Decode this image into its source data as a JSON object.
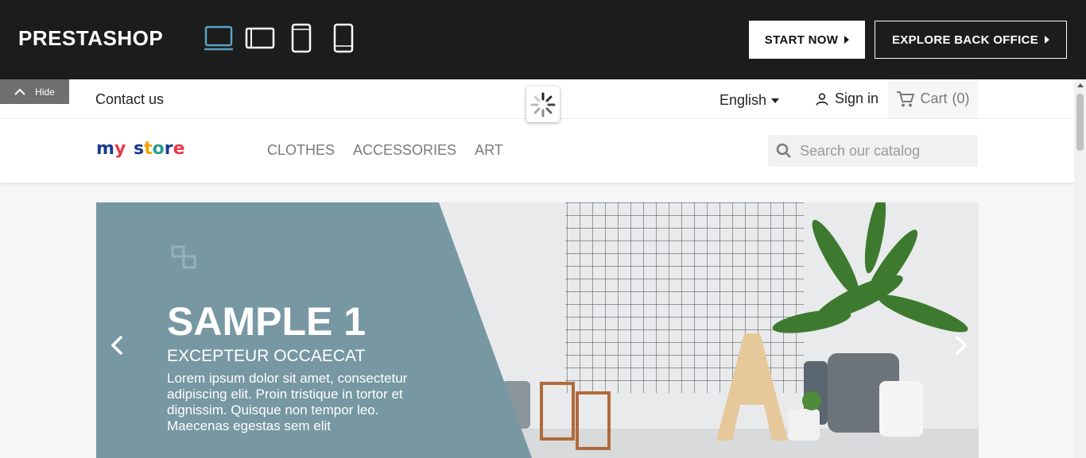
{
  "demo_bar": {
    "logo": "PRESTASHOP",
    "devices": [
      "desktop-icon",
      "tablet-landscape-icon",
      "tablet-portrait-icon",
      "mobile-icon"
    ],
    "active_device_color": "#5aa2c5",
    "start_label": "START NOW",
    "explore_label": "EXPLORE BACK OFFICE"
  },
  "store": {
    "hide_label": "Hide",
    "contact_label": "Contact us",
    "language": "English",
    "signin_label": "Sign in",
    "cart_label": "Cart",
    "cart_count": "(0)",
    "brand_letters": [
      {
        "ch": "m",
        "color": "#1a3b8c"
      },
      {
        "ch": "y",
        "color": "#e63946"
      },
      {
        "ch": " ",
        "color": "#000"
      },
      {
        "ch": "s",
        "color": "#1a3b8c"
      },
      {
        "ch": "t",
        "color": "#f4a300"
      },
      {
        "ch": "o",
        "color": "#2a9d8f"
      },
      {
        "ch": "r",
        "color": "#1a3b8c"
      },
      {
        "ch": "e",
        "color": "#e63946"
      }
    ],
    "menu": [
      "CLOTHES",
      "ACCESSORIES",
      "ART"
    ],
    "search_placeholder": "Search our catalog"
  },
  "slide": {
    "title": "SAMPLE 1",
    "subtitle": "EXCEPTEUR OCCAECAT",
    "description": "Lorem ipsum dolor sit amet, consectetur adipiscing elit. Proin tristique in tortor et dignissim. Quisque non tempor leo. Maecenas egestas sem elit",
    "panel_color": "#7797a3"
  }
}
